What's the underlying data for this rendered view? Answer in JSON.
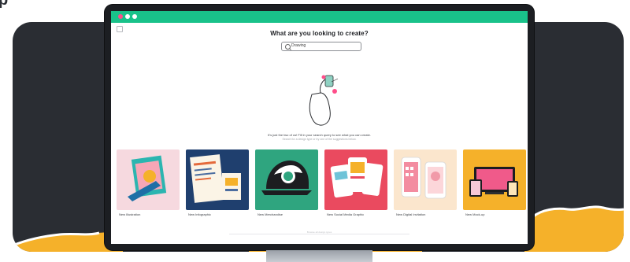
{
  "screen": {
    "heading": "What are you looking to create?",
    "search_value": "Drawing",
    "message_primary": "It's just the two of us! Fill in your search query to see what you can create.",
    "message_secondary": "Search for a design type or try one of the suggestions below.",
    "footer_text": "Browse all design types"
  },
  "cards": [
    {
      "label": "New Illustration",
      "icon": "illustration-thumbnail"
    },
    {
      "label": "New Infographic",
      "icon": "infographic-thumbnail"
    },
    {
      "label": "New Merchandise",
      "icon": "merchandise-thumbnail"
    },
    {
      "label": "New Social Media Graphic",
      "icon": "social-media-thumbnail"
    },
    {
      "label": "New Digital Invitation",
      "icon": "digital-invitation-thumbnail"
    },
    {
      "label": "New Mock-up",
      "icon": "mockup-thumbnail"
    }
  ],
  "colors": {
    "titlebar": "#19c28a",
    "backdrop": "#2a2d33",
    "accent_wave": "#f5b12a",
    "dot_red": "#ff4e8a"
  }
}
